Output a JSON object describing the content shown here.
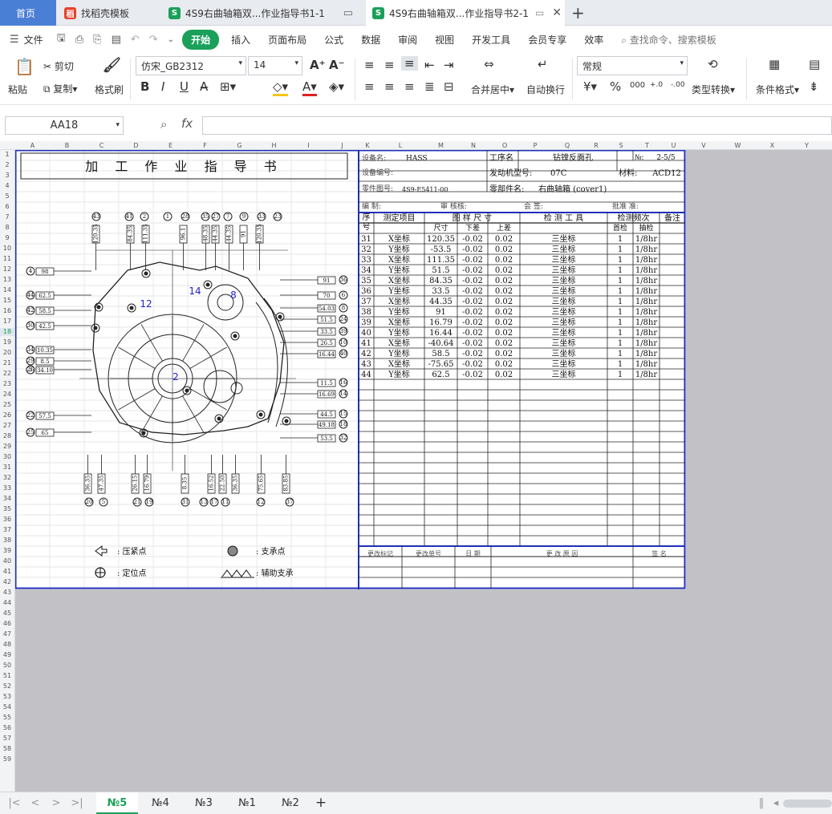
{
  "tabs": [
    {
      "label": "首页",
      "active": false,
      "home": true
    },
    {
      "label": "找稻壳模板",
      "active": false
    },
    {
      "label": "4S9右曲轴箱双...作业指导书1-1",
      "active": false
    },
    {
      "label": "4S9右曲轴箱双...作业指导书2-1",
      "active": true
    }
  ],
  "menu": {
    "file": "文件",
    "items": [
      "开始",
      "插入",
      "页面布局",
      "公式",
      "数据",
      "审阅",
      "视图",
      "开发工具",
      "会员专享",
      "效率"
    ],
    "active": "开始",
    "search": "查找命令、搜索模板"
  },
  "ribbon": {
    "paste": "粘贴",
    "cut": "剪切",
    "copy": "复制",
    "format_painter": "格式刷",
    "font": "仿宋_GB2312",
    "size": "14",
    "merge": "合并居中",
    "wrap": "自动换行",
    "number_format": "常规",
    "type_convert": "类型转换",
    "cond_format": "条件格式"
  },
  "formula": {
    "cell_ref": "AA18",
    "fx": "fx"
  },
  "columns": [
    "A",
    "B",
    "C",
    "D",
    "E",
    "F",
    "G",
    "H",
    "I",
    "J",
    "K",
    "L",
    "M",
    "N",
    "O",
    "P",
    "Q",
    "R",
    "S",
    "T",
    "U",
    "V",
    "W",
    "X",
    "Y"
  ],
  "rows": [
    "1",
    "2",
    "3",
    "4",
    "5",
    "6",
    "7",
    "8",
    "9",
    "10",
    "11",
    "12",
    "13",
    "14",
    "15",
    "16",
    "17",
    "18",
    "19",
    "20",
    "21",
    "22",
    "23",
    "24",
    "25",
    "26",
    "27",
    "28",
    "29",
    "30",
    "31",
    "32",
    "33",
    "34",
    "35",
    "36",
    "37",
    "38",
    "39",
    "40",
    "41",
    "42",
    "43",
    "44",
    "45",
    "46",
    "47",
    "48",
    "49",
    "50",
    "51",
    "52",
    "53",
    "54",
    "55",
    "56",
    "57",
    "58",
    "59"
  ],
  "doc": {
    "title": "加 工 作 业 指 导 书",
    "equip_name_label": "设备名:",
    "equip_name": "HASS",
    "process_label": "工序名",
    "process": "钻镗反面孔",
    "no_label": "№:",
    "no": "2-5/5",
    "equip_no_label": "设备编号:",
    "engine_label": "发动机型号:",
    "engine": "07C",
    "material_label": "材料:",
    "material": "ACD12",
    "part_no_label": "零件图号:",
    "part_no": "4S9-E5411-00",
    "part_name_label": "零部件名:",
    "part_name": "右曲轴箱 (cover1)",
    "compile_label": "编 制:",
    "review_label": "审 核核:",
    "sign_label": "会 签:",
    "approve_label": "批准 准:",
    "hdr_seq": "序号",
    "hdr_item": "测定项目",
    "hdr_dim": "图 样 尺 寸",
    "hdr_size": "尺寸",
    "hdr_low": "下差",
    "hdr_up": "上差",
    "hdr_tool": "检 测 工 具",
    "hdr_freq": "检测频次",
    "hdr_first": "首检",
    "hdr_sample": "抽检",
    "hdr_note": "备注",
    "rows": [
      {
        "no": "31",
        "item": "X坐标",
        "size": "120.35",
        "low": "-0.02",
        "up": "0.02",
        "tool": "三坐标",
        "first": "1",
        "sample": "1/8hr"
      },
      {
        "no": "32",
        "item": "Y坐标",
        "size": "-53.5",
        "low": "-0.02",
        "up": "0.02",
        "tool": "三坐标",
        "first": "1",
        "sample": "1/8hr"
      },
      {
        "no": "33",
        "item": "X坐标",
        "size": "111.35",
        "low": "-0.02",
        "up": "0.02",
        "tool": "三坐标",
        "first": "1",
        "sample": "1/8hr"
      },
      {
        "no": "34",
        "item": "Y坐标",
        "size": "51.5",
        "low": "-0.02",
        "up": "0.02",
        "tool": "三坐标",
        "first": "1",
        "sample": "1/8hr"
      },
      {
        "no": "35",
        "item": "X坐标",
        "size": "84.35",
        "low": "-0.02",
        "up": "0.02",
        "tool": "三坐标",
        "first": "1",
        "sample": "1/8hr"
      },
      {
        "no": "36",
        "item": "Y坐标",
        "size": "33.5",
        "low": "-0.02",
        "up": "0.02",
        "tool": "三坐标",
        "first": "1",
        "sample": "1/8hr"
      },
      {
        "no": "37",
        "item": "X坐标",
        "size": "44.35",
        "low": "-0.02",
        "up": "0.02",
        "tool": "三坐标",
        "first": "1",
        "sample": "1/8hr"
      },
      {
        "no": "38",
        "item": "Y坐标",
        "size": "91",
        "low": "-0.02",
        "up": "0.02",
        "tool": "三坐标",
        "first": "1",
        "sample": "1/8hr"
      },
      {
        "no": "39",
        "item": "X坐标",
        "size": "16.79",
        "low": "-0.02",
        "up": "0.02",
        "tool": "三坐标",
        "first": "1",
        "sample": "1/8hr"
      },
      {
        "no": "40",
        "item": "Y坐标",
        "size": "16.44",
        "low": "-0.02",
        "up": "0.02",
        "tool": "三坐标",
        "first": "1",
        "sample": "1/8hr"
      },
      {
        "no": "41",
        "item": "X坐标",
        "size": "-40.64",
        "low": "-0.02",
        "up": "0.02",
        "tool": "三坐标",
        "first": "1",
        "sample": "1/8hr"
      },
      {
        "no": "42",
        "item": "Y坐标",
        "size": "58.5",
        "low": "-0.02",
        "up": "0.02",
        "tool": "三坐标",
        "first": "1",
        "sample": "1/8hr"
      },
      {
        "no": "43",
        "item": "X坐标",
        "size": "-75.65",
        "low": "-0.02",
        "up": "0.02",
        "tool": "三坐标",
        "first": "1",
        "sample": "1/8hr"
      },
      {
        "no": "44",
        "item": "Y坐标",
        "size": "62.5",
        "low": "-0.02",
        "up": "0.02",
        "tool": "三坐标",
        "first": "1",
        "sample": "1/8hr"
      }
    ],
    "change_mark": "更改标记",
    "change_no": "更改单号",
    "change_date": "日 期",
    "change_reason": "更 改 原 因",
    "change_sign": "签 名",
    "legend_clamp": ": 压紧点",
    "legend_support": ": 支承点",
    "legend_locate": ": 定位点",
    "legend_aux": ": 辅助支承",
    "drawing": {
      "top_circles": [
        "43",
        "41",
        "2",
        "1",
        "28",
        "35",
        "27",
        "7",
        "9",
        "33",
        "23"
      ],
      "top_dims": [
        "120.35",
        "84.35",
        "111.35",
        "96.1",
        "48.35",
        "44.35",
        "44.35",
        "91",
        "120.35"
      ],
      "left_circles": [
        "4",
        "44",
        "42",
        "30",
        "34",
        "29",
        "3",
        "22",
        "25",
        "26"
      ],
      "left_dims": [
        "98",
        "62.5",
        "58.5",
        "42.5",
        "10.35",
        "8.5",
        "34.10",
        "57.5",
        "65"
      ],
      "right_circles": [
        "36",
        "6",
        "8",
        "24",
        "39",
        "10",
        "40",
        "16",
        "14",
        "15",
        "18",
        "32"
      ],
      "right_dims": [
        "91",
        "70",
        "54.03",
        "51.5",
        "33.5",
        "26.5",
        "16.44",
        "11.5",
        "16.69",
        "44.5",
        "49.18",
        "53.5"
      ],
      "bottom_circles": [
        "20",
        "5",
        "21",
        "19",
        "31",
        "13",
        "17",
        "11",
        "12",
        "37"
      ],
      "bottom_dims": [
        "36.35",
        "47.35",
        "26.15",
        "16.79",
        "8.35",
        "16.52",
        "22.50",
        "36.35",
        "75.65",
        "83.85"
      ],
      "blue_labels": [
        "12",
        "14",
        "8",
        "2"
      ]
    }
  },
  "sheet_tabs": [
    "№5",
    "№4",
    "№3",
    "№1",
    "№2"
  ],
  "active_sheet": "№5"
}
